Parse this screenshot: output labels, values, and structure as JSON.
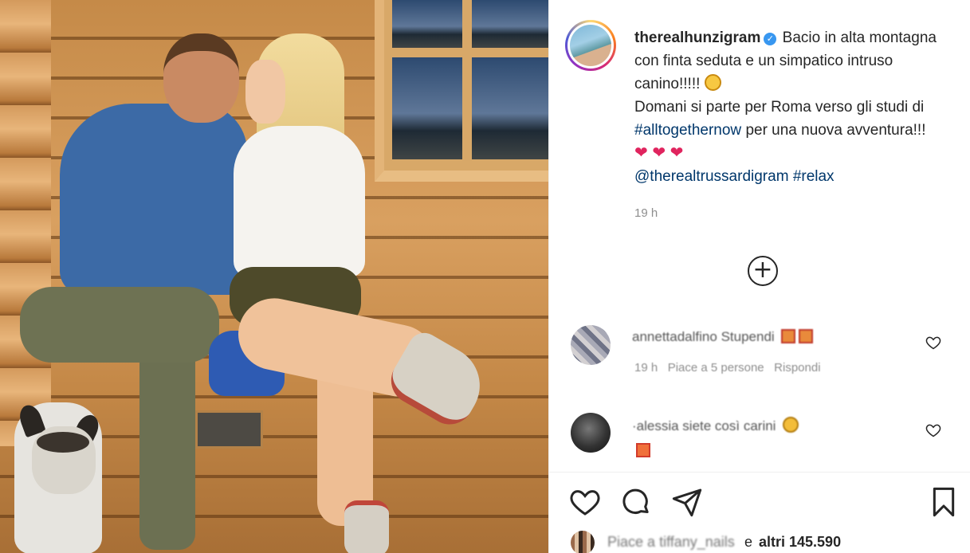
{
  "post": {
    "username": "therealhunzigram",
    "verified_glyph": "✓",
    "caption_line1": "Bacio in alta montagna con finta seduta e un simpatico intruso canino!!!!!",
    "caption_line2": "Domani si parte per Roma verso gli studi di",
    "hashtag_show": "#alltogethernow",
    "caption_line3": "per una nuova avventura!!!",
    "hearts": "❤ ❤ ❤",
    "mention": "@therealtrussardigram",
    "hashtag_relax": "#relax",
    "time": "19 h"
  },
  "comments": [
    {
      "user": "annettadalfino",
      "text": "Stupendi",
      "meta_time": "19 h",
      "meta_likes": "Piace a 5 persone",
      "reply": "Rispondi"
    },
    {
      "text": "·alessia siete così carini"
    }
  ],
  "likes": {
    "prefix": "Piace a",
    "blurred_user": "tiffany_nails",
    "and": "e",
    "others": "altri 145.590"
  },
  "icons": {
    "add": "plus-circle-icon",
    "like": "heart-icon",
    "comment": "comment-bubble-icon",
    "share": "send-icon",
    "save": "bookmark-icon",
    "comment_like": "heart-outline-icon"
  },
  "colors": {
    "link": "#00376b",
    "verified": "#3897f0",
    "muted": "#8e8e8e",
    "text": "#262626"
  }
}
